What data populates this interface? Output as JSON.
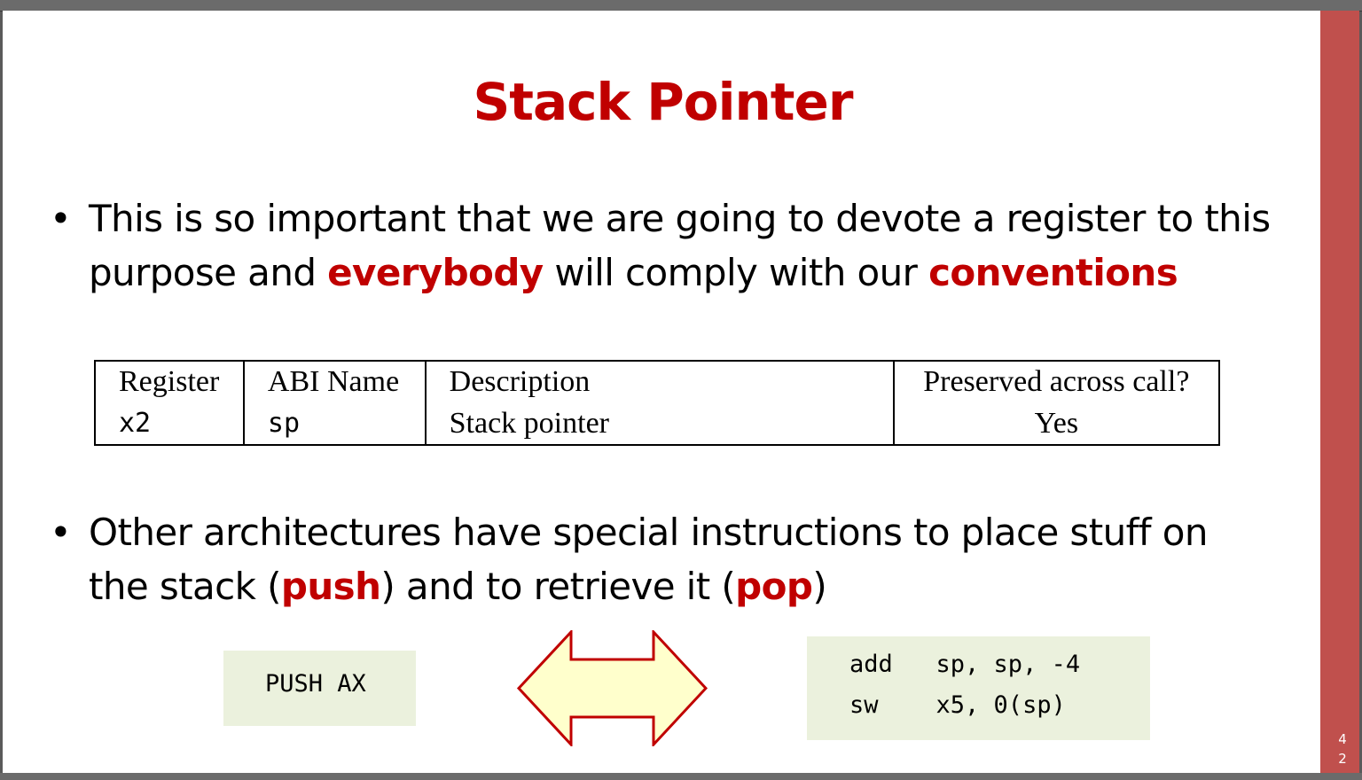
{
  "slide": {
    "title": "Stack Pointer",
    "page_number_digits": [
      "4",
      "2"
    ],
    "bullet1": {
      "bullet": "•",
      "line1": "This is so important that we are going to devote a register to this",
      "line2_a": "purpose and ",
      "line2_hl1": "everybody",
      "line2_b": " will comply with our ",
      "line2_hl2": "conventions"
    },
    "table": {
      "headers": [
        "Register",
        "ABI Name",
        "Description",
        "Preserved across call?"
      ],
      "row": [
        "x2",
        "sp",
        "Stack pointer",
        "Yes"
      ]
    },
    "bullet2": {
      "bullet": "•",
      "line1": "Other architectures have special instructions to place stuff on",
      "line2_a": "the stack (",
      "line2_hl1": "push",
      "line2_b": ") and to retrieve it (",
      "line2_hl2": "pop",
      "line2_c": ")"
    },
    "code_left": {
      "line1": "PUSH AX"
    },
    "code_right": {
      "line1": "add   sp, sp, -4",
      "line2": "sw    x5, 0(sp)"
    }
  },
  "colors": {
    "accent_red": "#c00000",
    "sidebar": "#c0504d",
    "code_bg": "#ebf1dd",
    "arrow_fill": "#ffffcc",
    "arrow_stroke": "#c00000"
  },
  "icons": {
    "double_arrow": "double-headed-arrow-icon"
  }
}
